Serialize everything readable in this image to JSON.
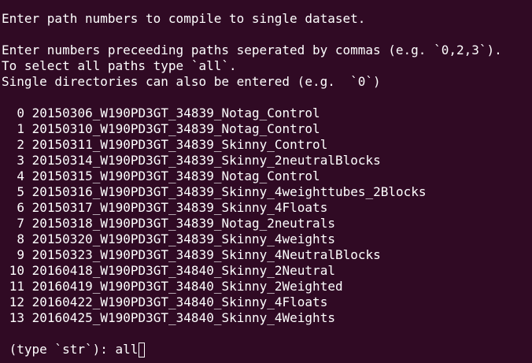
{
  "terminal": {
    "background": "#300a24",
    "foreground": "#ffffff",
    "intro": "Enter path numbers to compile to single dataset.",
    "instructions": [
      "Enter numbers preceeding paths seperated by commas (e.g. `0,2,3`).",
      "To select all paths type `all`.",
      "Single directories can also be entered (e.g.  `0`)"
    ],
    "paths": [
      {
        "index": "0",
        "name": "20150306_W190PD3GT_34839_Notag_Control"
      },
      {
        "index": "1",
        "name": "20150310_W190PD3GT_34839_Notag_Control"
      },
      {
        "index": "2",
        "name": "20150311_W190PD3GT_34839_Skinny_Control"
      },
      {
        "index": "3",
        "name": "20150314_W190PD3GT_34839_Skinny_2neutralBlocks"
      },
      {
        "index": "4",
        "name": "20150315_W190PD3GT_34839_Notag_Control"
      },
      {
        "index": "5",
        "name": "20150316_W190PD3GT_34839_Skinny_4weighttubes_2Blocks"
      },
      {
        "index": "6",
        "name": "20150317_W190PD3GT_34839_Skinny_4Floats"
      },
      {
        "index": "7",
        "name": "20150318_W190PD3GT_34839_Notag_2neutrals"
      },
      {
        "index": "8",
        "name": "20150320_W190PD3GT_34839_Skinny_4weights"
      },
      {
        "index": "9",
        "name": "20150323_W190PD3GT_34839_Skinny_4NeutralBlocks"
      },
      {
        "index": "10",
        "name": "20160418_W190PD3GT_34840_Skinny_2Neutral"
      },
      {
        "index": "11",
        "name": "20160419_W190PD3GT_34840_Skinny_2Weighted"
      },
      {
        "index": "12",
        "name": "20160422_W190PD3GT_34840_Skinny_4Floats"
      },
      {
        "index": "13",
        "name": "20160425_W190PD3GT_34840_Skinny_4Weights"
      }
    ],
    "prompt": " (type `str`): ",
    "input_value": "all"
  }
}
